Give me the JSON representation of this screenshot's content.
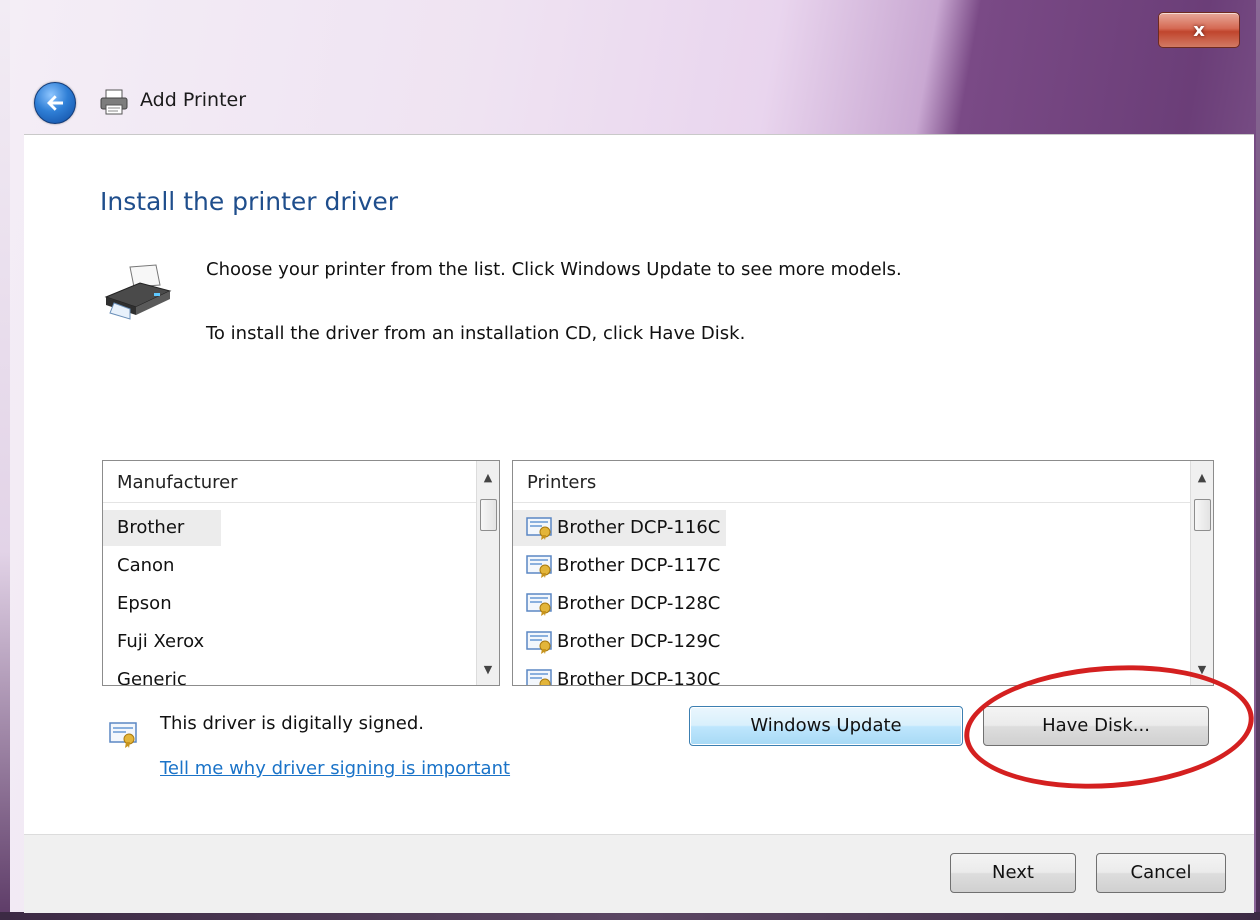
{
  "window": {
    "title": "Add Printer",
    "close_glyph": "x"
  },
  "page": {
    "heading": "Install the printer driver",
    "instruction_1": "Choose your printer from the list. Click Windows Update to see more models.",
    "instruction_2": "To install the driver from an installation CD, click Have Disk."
  },
  "manufacturer_list": {
    "header": "Manufacturer",
    "items": [
      "Brother",
      "Canon",
      "Epson",
      "Fuji Xerox",
      "Generic"
    ],
    "selected": "Brother"
  },
  "printers_list": {
    "header": "Printers",
    "items": [
      "Brother DCP-116C",
      "Brother DCP-117C",
      "Brother DCP-128C",
      "Brother DCP-129C",
      "Brother DCP-130C"
    ],
    "selected": "Brother DCP-116C"
  },
  "buttons": {
    "windows_update": "Windows Update",
    "have_disk": "Have Disk...",
    "next": "Next",
    "cancel": "Cancel"
  },
  "signing": {
    "status": "This driver is digitally signed.",
    "link": "Tell me why driver signing is important"
  },
  "colors": {
    "heading": "#1f4e8c",
    "link": "#1a73c8",
    "annotation": "#d42020"
  },
  "icons": {
    "back": "back-arrow-icon",
    "title_printer": "printer-icon",
    "large_printer": "printer-icon",
    "certificate": "certificate-icon"
  }
}
